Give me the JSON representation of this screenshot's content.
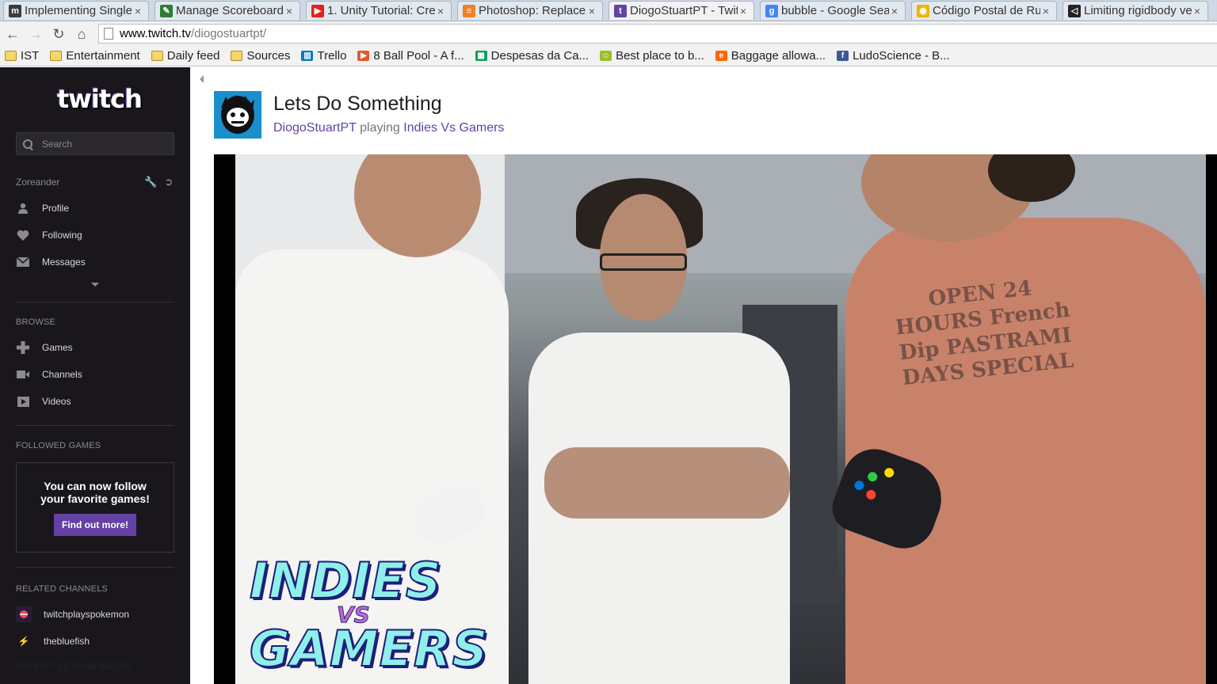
{
  "browser": {
    "tabs": [
      {
        "title": "Implementing Single",
        "icon": "m-icon",
        "color": "#3c3c3c",
        "active": false
      },
      {
        "title": "Manage Scoreboards",
        "icon": "editor-icon",
        "color": "#2e7d32",
        "active": false
      },
      {
        "title": "1. Unity Tutorial: Cre",
        "icon": "youtube-icon",
        "color": "#e62117",
        "active": false
      },
      {
        "title": "Photoshop: Replace",
        "icon": "stack-icon",
        "color": "#f48024",
        "active": false
      },
      {
        "title": "DiogoStuartPT - Twit",
        "icon": "twitch-icon",
        "color": "#6441a5",
        "active": true
      },
      {
        "title": "bubble - Google Sea",
        "icon": "google-icon",
        "color": "#4285f4",
        "active": false
      },
      {
        "title": "Código Postal de Ru",
        "icon": "map-icon",
        "color": "#f0b400",
        "active": false
      },
      {
        "title": "Limiting rigidbody ve",
        "icon": "unity-icon",
        "color": "#222222",
        "active": false
      }
    ],
    "url": {
      "host": "www.twitch.tv",
      "path": "/diogostuartpt/"
    },
    "bookmarks": [
      {
        "label": "IST",
        "icon": "folder-icon"
      },
      {
        "label": "Entertainment",
        "icon": "folder-icon"
      },
      {
        "label": "Daily feed",
        "icon": "folder-icon"
      },
      {
        "label": "Sources",
        "icon": "folder-icon"
      },
      {
        "label": "Trello",
        "icon": "trello-icon",
        "color": "#0079bf"
      },
      {
        "label": "8 Ball Pool - A f...",
        "icon": "game-icon",
        "color": "#e4572e"
      },
      {
        "label": "Despesas da Ca...",
        "icon": "sheets-icon",
        "color": "#0f9d58"
      },
      {
        "label": "Best place to b...",
        "icon": "smiley-icon",
        "color": "#9bbf2a"
      },
      {
        "label": "Baggage allowa...",
        "icon": "easyjet-icon",
        "color": "#ff6600"
      },
      {
        "label": "LudoScience - B...",
        "icon": "facebook-icon",
        "color": "#3b5998"
      }
    ]
  },
  "sidebar": {
    "logo": "twitch",
    "search_placeholder": "Search",
    "username": "Zoreander",
    "user_nav": [
      {
        "label": "Profile",
        "icon": "person-icon"
      },
      {
        "label": "Following",
        "icon": "heart-icon"
      },
      {
        "label": "Messages",
        "icon": "envelope-icon"
      }
    ],
    "browse_title": "BROWSE",
    "browse_nav": [
      {
        "label": "Games",
        "icon": "gamepad-icon"
      },
      {
        "label": "Channels",
        "icon": "camera-icon"
      },
      {
        "label": "Videos",
        "icon": "play-icon"
      }
    ],
    "followed_games_title": "FOLLOWED GAMES",
    "follow_promo": {
      "line1": "You can now follow",
      "line2": "your favorite games!",
      "button": "Find out more!"
    },
    "related_title": "RELATED CHANNELS",
    "related_channels": [
      {
        "name": "twitchplayspokemon",
        "icon": "pokemon-avatar"
      },
      {
        "name": "thebluefish",
        "icon": "lightning-icon"
      }
    ],
    "timestamp": "2015-07-18 22:48:500.76"
  },
  "channel": {
    "title": "Lets Do Something",
    "broadcaster": "DiogoStuartPT",
    "playing_word": "playing",
    "game": "Indies Vs Gamers"
  },
  "video": {
    "logo_top": "INDIES",
    "logo_mid": "VS",
    "logo_bottom": "GAMERS",
    "shirt_text": "OPEN 24 HOURS French Dip PASTRAMI DAYS SPECIAL"
  },
  "colors": {
    "twitch_purple": "#6441a5",
    "sidebar_bg": "#19171c"
  }
}
